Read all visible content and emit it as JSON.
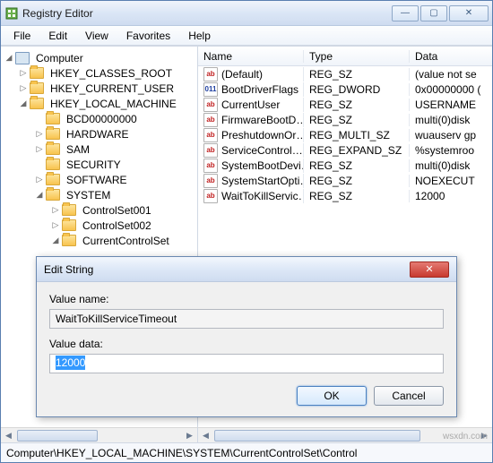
{
  "window": {
    "title": "Registry Editor",
    "menu": [
      "File",
      "Edit",
      "View",
      "Favorites",
      "Help"
    ],
    "buttons": {
      "min": "—",
      "max": "▢",
      "close": "✕"
    }
  },
  "tree": {
    "root": "Computer",
    "keys": [
      {
        "name": "HKEY_CLASSES_ROOT",
        "expand": "closed",
        "indent": 1
      },
      {
        "name": "HKEY_CURRENT_USER",
        "expand": "closed",
        "indent": 1
      },
      {
        "name": "HKEY_LOCAL_MACHINE",
        "expand": "open",
        "indent": 1
      },
      {
        "name": "BCD00000000",
        "expand": "none",
        "indent": 2
      },
      {
        "name": "HARDWARE",
        "expand": "closed",
        "indent": 2
      },
      {
        "name": "SAM",
        "expand": "closed",
        "indent": 2
      },
      {
        "name": "SECURITY",
        "expand": "none",
        "indent": 2
      },
      {
        "name": "SOFTWARE",
        "expand": "closed",
        "indent": 2
      },
      {
        "name": "SYSTEM",
        "expand": "open",
        "indent": 2
      },
      {
        "name": "ControlSet001",
        "expand": "closed",
        "indent": 3
      },
      {
        "name": "ControlSet002",
        "expand": "closed",
        "indent": 3
      },
      {
        "name": "CurrentControlSet",
        "expand": "open",
        "indent": 3
      }
    ]
  },
  "list": {
    "headers": {
      "name": "Name",
      "type": "Type",
      "data": "Data"
    },
    "rows": [
      {
        "icon": "str",
        "name": "(Default)",
        "type": "REG_SZ",
        "data": "(value not se"
      },
      {
        "icon": "bin",
        "name": "BootDriverFlags",
        "type": "REG_DWORD",
        "data": "0x00000000 ("
      },
      {
        "icon": "str",
        "name": "CurrentUser",
        "type": "REG_SZ",
        "data": "USERNAME"
      },
      {
        "icon": "str",
        "name": "FirmwareBootD…",
        "type": "REG_SZ",
        "data": "multi(0)disk"
      },
      {
        "icon": "str",
        "name": "PreshutdownOr…",
        "type": "REG_MULTI_SZ",
        "data": "wuauserv gp"
      },
      {
        "icon": "str",
        "name": "ServiceControl…",
        "type": "REG_EXPAND_SZ",
        "data": "%systemroo"
      },
      {
        "icon": "str",
        "name": "SystemBootDevi…",
        "type": "REG_SZ",
        "data": "multi(0)disk"
      },
      {
        "icon": "str",
        "name": "SystemStartOpti…",
        "type": "REG_SZ",
        "data": " NOEXECUT"
      },
      {
        "icon": "str",
        "name": "WaitToKillServic…",
        "type": "REG_SZ",
        "data": "12000"
      }
    ]
  },
  "statusbar": "Computer\\HKEY_LOCAL_MACHINE\\SYSTEM\\CurrentControlSet\\Control",
  "dialog": {
    "title": "Edit String",
    "name_label": "Value name:",
    "name_value": "WaitToKillServiceTimeout",
    "data_label": "Value data:",
    "data_value": "12000",
    "ok": "OK",
    "cancel": "Cancel",
    "close": "✕"
  },
  "watermark": "wsxdn.com"
}
